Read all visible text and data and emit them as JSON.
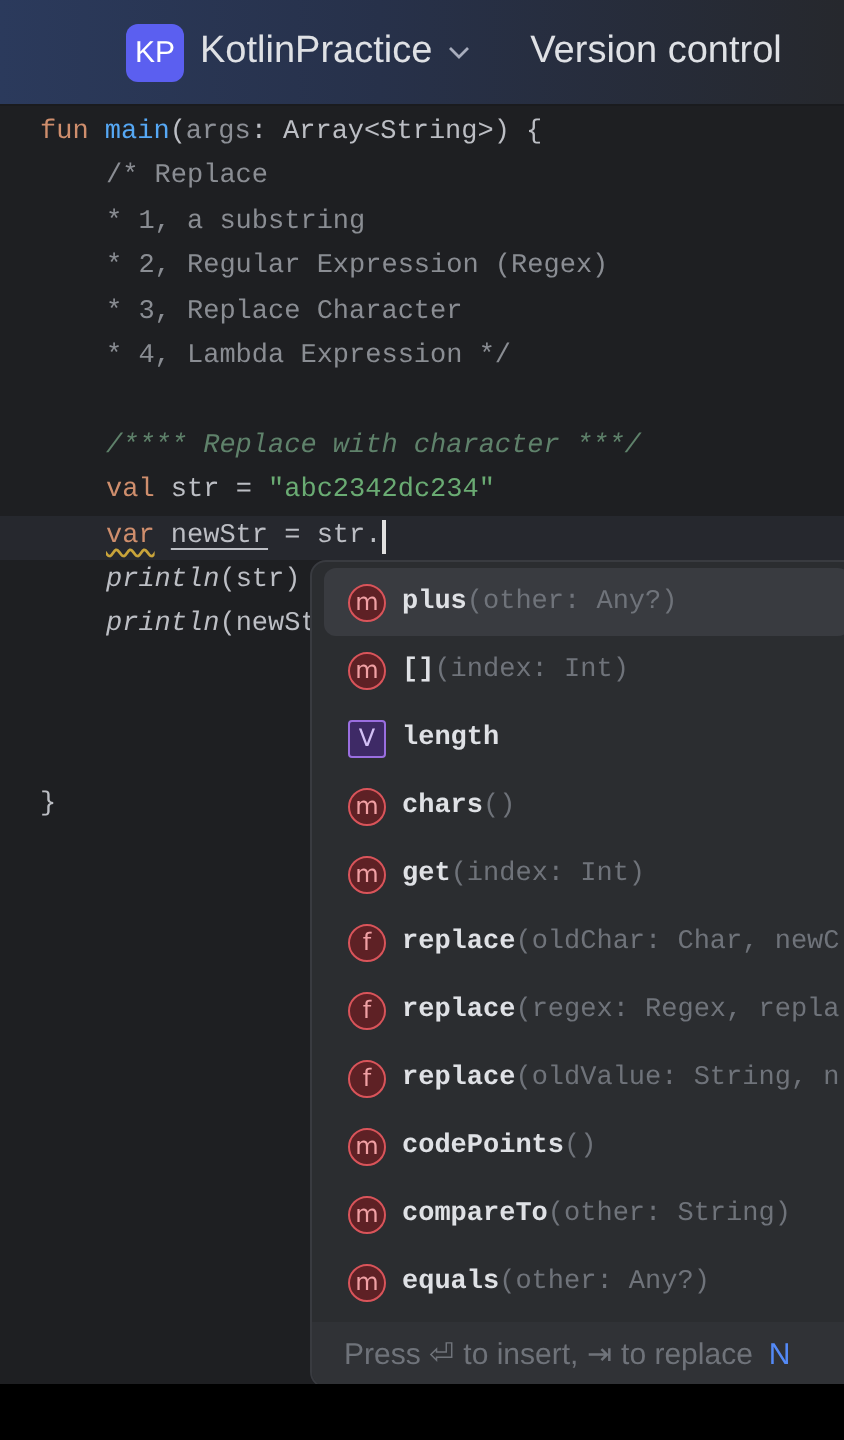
{
  "header": {
    "logo": "KP",
    "project": "KotlinPractice",
    "menu": "Version control"
  },
  "code_lines": [
    {
      "kind": "top",
      "tokens": [
        {
          "text": "fun ",
          "kind": "keyword"
        },
        {
          "text": "main",
          "kind": "function"
        },
        {
          "text": "(",
          "kind": "plain"
        },
        {
          "text": "args",
          "kind": "param"
        },
        {
          "text": ": Array<String>) {",
          "kind": "plain"
        }
      ]
    },
    {
      "kind": "body",
      "tokens": [
        {
          "text": "/* Replace",
          "kind": "comment"
        }
      ]
    },
    {
      "kind": "body",
      "tokens": [
        {
          "text": "* 1, a substring",
          "kind": "comment"
        }
      ]
    },
    {
      "kind": "body",
      "tokens": [
        {
          "text": "* 2, Regular Expression (Regex)",
          "kind": "comment"
        }
      ]
    },
    {
      "kind": "body",
      "tokens": [
        {
          "text": "* 3, Replace Character",
          "kind": "comment"
        }
      ]
    },
    {
      "kind": "body",
      "tokens": [
        {
          "text": "* 4, Lambda Expression */",
          "kind": "comment"
        }
      ]
    },
    {
      "kind": "blank"
    },
    {
      "kind": "body",
      "tokens": [
        {
          "text": "/**** Replace with character ***/",
          "kind": "doc"
        }
      ]
    },
    {
      "kind": "body",
      "tokens": [
        {
          "text": "val",
          "kind": "keyword"
        },
        {
          "text": " str = ",
          "kind": "plain"
        },
        {
          "text": "\"abc2342dc234\"",
          "kind": "string"
        }
      ]
    },
    {
      "kind": "body",
      "current": true,
      "tokens": [
        {
          "text": "var",
          "kind": "warning"
        },
        {
          "text": "newStr",
          "kind": "underlined"
        },
        {
          "text": " = str.",
          "kind": "plain"
        }
      ]
    },
    {
      "kind": "body",
      "tokens": [
        {
          "text": "println",
          "kind": "call"
        },
        {
          "text": "(str)",
          "kind": "plain"
        }
      ]
    },
    {
      "kind": "body",
      "tokens": [
        {
          "text": "println",
          "kind": "call"
        },
        {
          "text": "(newSt",
          "kind": "plain"
        }
      ]
    },
    {
      "kind": "blank"
    },
    {
      "kind": "blank"
    },
    {
      "kind": "blank"
    },
    {
      "kind": "top",
      "tokens": [
        {
          "text": "}",
          "kind": "plain"
        }
      ]
    }
  ],
  "completion": {
    "items": [
      {
        "kind": "method",
        "badge": "m",
        "name": "plus",
        "signature": "(other: Any?)",
        "selected": true
      },
      {
        "kind": "method",
        "badge": "m",
        "name": "[]",
        "signature": "(index: Int)",
        "selected": false
      },
      {
        "kind": "variable",
        "badge": "V",
        "name": "length",
        "selected": false
      },
      {
        "kind": "method",
        "badge": "m",
        "name": "chars",
        "signature": "()",
        "selected": false
      },
      {
        "kind": "method",
        "badge": "m",
        "name": "get",
        "signature": "(index: Int)",
        "selected": false
      },
      {
        "kind": "function",
        "badge": "f",
        "name": "replace",
        "signature": "(oldChar: Char, newC",
        "selected": false
      },
      {
        "kind": "function",
        "badge": "f",
        "name": "replace",
        "signature": "(regex: Regex, repla",
        "selected": false
      },
      {
        "kind": "function",
        "badge": "f",
        "name": "replace",
        "signature": "(oldValue: String, n",
        "selected": false
      },
      {
        "kind": "method",
        "badge": "m",
        "name": "codePoints",
        "signature": "()",
        "selected": false
      },
      {
        "kind": "method",
        "badge": "m",
        "name": "compareTo",
        "signature": "(other: String)",
        "selected": false
      },
      {
        "kind": "method",
        "badge": "m",
        "name": "equals",
        "signature": "(other: Any?)",
        "selected": false
      }
    ],
    "hint": "Press ⏎ to insert, ⇥ to replace",
    "hint_link": "N"
  }
}
